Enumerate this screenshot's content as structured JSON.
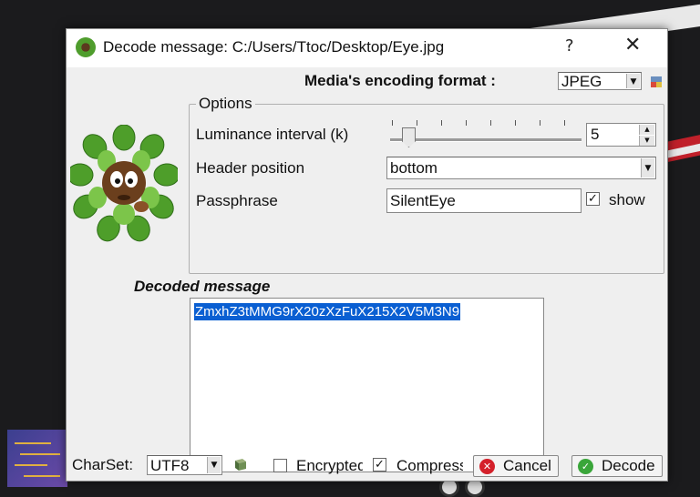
{
  "window": {
    "title": "Decode message: C:/Users/Ttoc/Desktop/Eye.jpg",
    "help_glyph": "?",
    "close_glyph": "✕"
  },
  "encoding": {
    "label": "Media's encoding format :",
    "value": "JPEG"
  },
  "options": {
    "title": "Options",
    "luminance_label": "Luminance interval (k)",
    "luminance_value": "5",
    "header_label": "Header position",
    "header_value": "bottom",
    "passphrase_label": "Passphrase",
    "passphrase_value": "SilentEye",
    "show_label": "show",
    "show_checked": "✓"
  },
  "decoded": {
    "label": "Decoded message",
    "text": "ZmxhZ3tMMG9rX20zXzFuX215X2V5M3N9"
  },
  "footer": {
    "charset_label": "CharSet:",
    "charset_value": "UTF8",
    "encrypted_label": "Encrypted",
    "compressed_label": "Compressed",
    "compressed_checked": "✓",
    "cancel_label": "Cancel",
    "decode_label": "Decode"
  },
  "icons": {
    "app": "silenteye-icon",
    "mascot": "mascot-icon",
    "format_settings": "settings-small-icon",
    "charset_book": "book-icon",
    "cancel": "cancel-icon",
    "decode": "check-icon"
  },
  "colors": {
    "selection": "#0a5fd2",
    "cancel_icon": "#d4202a",
    "decode_icon": "#3aa63a"
  }
}
